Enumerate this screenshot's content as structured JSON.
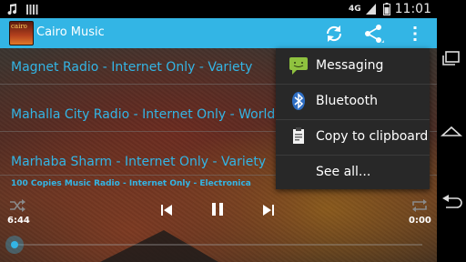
{
  "status_bar": {
    "network": "4G",
    "time": "11:01"
  },
  "app": {
    "title": "Cairo Music",
    "icon_text": "cairo"
  },
  "action_bar": {
    "icons": [
      "refresh-icon",
      "share-icon",
      "overflow-menu-icon"
    ]
  },
  "stations": [
    {
      "label": "Magnet Radio  - Internet Only  - Variety"
    },
    {
      "label": "Mahalla City Radio  - Internet Only  - World Music"
    },
    {
      "label": "Marhaba Sharm  - Internet Only  - Variety"
    }
  ],
  "now_playing": {
    "label": "100 Copies Music Radio   -   Internet Only   -   Electronica"
  },
  "player": {
    "elapsed": "6:44",
    "duration": "0:00",
    "progress": 0.0
  },
  "share_menu": {
    "items": [
      {
        "label": "Messaging",
        "icon": "messaging-icon"
      },
      {
        "label": "Bluetooth",
        "icon": "bluetooth-icon"
      },
      {
        "label": "Copy to clipboard",
        "icon": "clipboard-icon"
      },
      {
        "label": "See all...",
        "icon": ""
      }
    ]
  },
  "colors": {
    "accent": "#33b5e5",
    "popup_bg": "#282828"
  }
}
